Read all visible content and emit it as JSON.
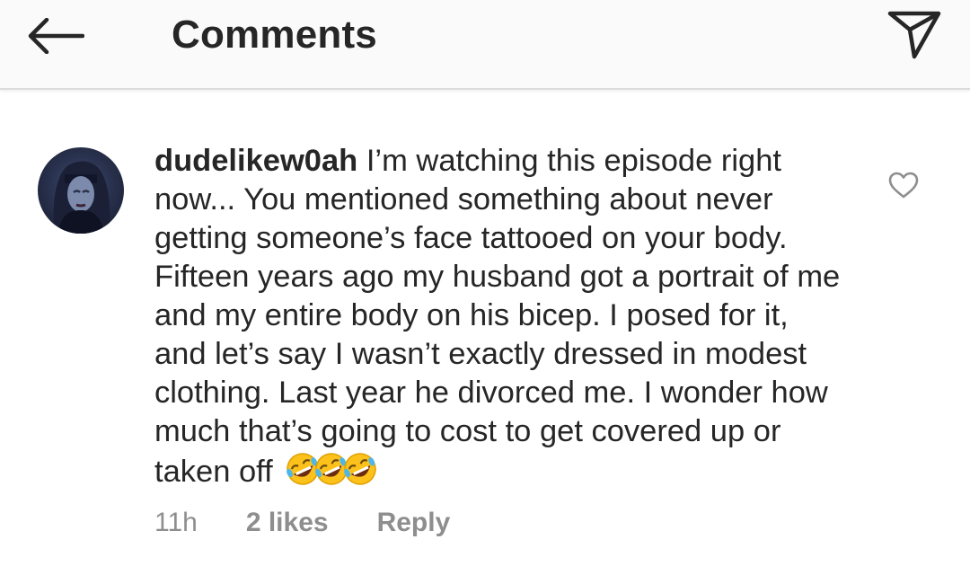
{
  "header": {
    "title": "Comments",
    "back_icon": "arrow-left-icon",
    "share_icon": "paper-plane-icon"
  },
  "comment": {
    "username": "dudelikew0ah",
    "text": "I’m watching this episode right now... You mentioned something about never getting someone’s face tattooed on your body. Fifteen years ago my husband got a portrait of me and my entire body on his bicep. I posed for it, and let’s say I wasn’t exactly dressed in modest clothing. Last year he divorced me. I wonder how much that’s going to cost to get covered up or taken off",
    "emoji": "rolling-on-floor-laughing-emoji x3",
    "time": "11h",
    "likes": "2 likes",
    "reply_label": "Reply",
    "like_icon": "heart-outline-icon"
  },
  "colors": {
    "text": "#262626",
    "meta": "#8e8e8e",
    "header_bg": "#fafafa",
    "divider": "#dbdbdb"
  }
}
